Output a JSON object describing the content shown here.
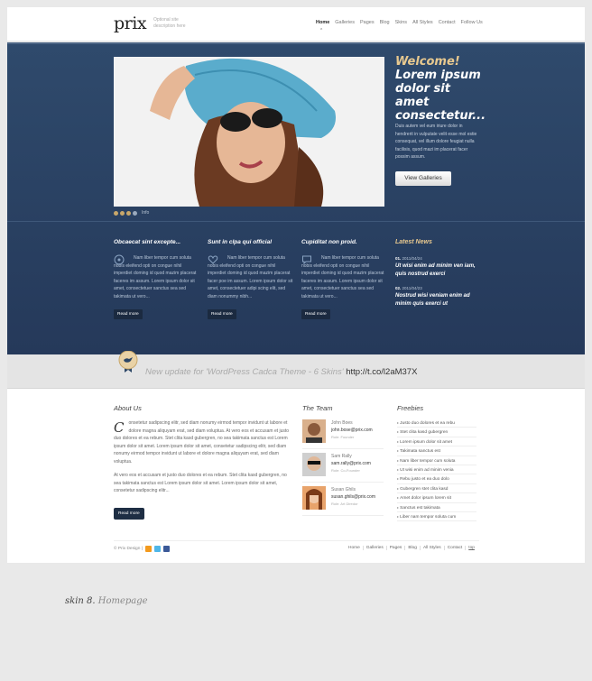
{
  "header": {
    "logo": "prix",
    "tagline": "Optional site description here",
    "nav": [
      "Home",
      "Galleries",
      "Pages",
      "Blog",
      "Skins",
      "All Styles",
      "Contact",
      "Follow Us"
    ]
  },
  "hero": {
    "welcome": "Welcome!",
    "headline": "Lorem ipsum dolor sit amet consectetur...",
    "text": "Duis autem vel eum iriure dolor in hendrerit in vulputate velit esse mol estie consequat, vel illum dolore feugiat nulla facilisis, quod mazi im placerat facer possim assum.",
    "button": "View Galleries",
    "slider_info": "Info"
  },
  "features": [
    {
      "title": "Obcaecat sint excepte...",
      "text": "Nam liber tempor cum soluta nobis eleifend opti on congue nihil imperdiet doming id quod mazim placerat faceres im assum. Lorem ipsum dolor sit amet, consectetuer sanctus sea sed takimata ut vero...",
      "button": "Read more",
      "icon": "circle-icon"
    },
    {
      "title": "Sunt in clpa qui official",
      "text": "Nam liber tempor cum soluta nobis eleifend opti on congue nihil imperdiet doming id quod mazim placerat facer poe im assum. Lorem ipsum dolor sit amet, consectetuer adipi scing elit, sed diam nonummy nibh...",
      "button": "Read more",
      "icon": "heart-icon"
    },
    {
      "title": "Cupiditat non proid.",
      "text": "Nam liber tempor cum soluta nobis eleifend opti on congue nihil imperdiet doming id quod mazim placerat faceres im assum. Lorem ipsum dolor sit amet, consectetuer sanctus sea sed takimata ut vero...",
      "button": "Read more",
      "icon": "comment-icon"
    }
  ],
  "news": {
    "title": "Latest News",
    "items": [
      {
        "num": "01.",
        "date": "2011/04/24",
        "text": "Ut wisi enim ad minim ven iam, quis nostrud exerci"
      },
      {
        "num": "02.",
        "date": "2011/04/23",
        "text": "Nostrud wisi veniam enim ad minim quis exerci ut"
      }
    ]
  },
  "ribbon": {
    "text": "New update for 'WordPress Cadca Theme - 6 Skins'",
    "link": "http://t.co/l2aM37X"
  },
  "about": {
    "title": "About Us",
    "dropcap": "C",
    "p1": "onsetetur sadipscing elitr, sed diam nonumy eirmod tempor invidunt ut labore et dolore magna aliquyam erat, sed diam voluptua. At vero eos et accusam et justo duo dolores et ea rebum. Stet clita kasd gubergren, no sea takimata sanctus est Lorem ipsum dolor sit amet. Lorem ipsum dolor sit amet, consetetur sadipscing elitr, sed diam nonumy eirmod tempor invidunt ut labore et dolore magna aliquyam erat, sed diam voluptua.",
    "p2": "At vero eos et accusam et justo duo dolores et ea rebum. Stet clita kasd gubergren, no sea takimata sanctus est Lorem ipsum dolor sit amet. Lorem ipsum dolor sit amet, consetetur sadipscing elitr...",
    "button": "Read more"
  },
  "team": {
    "title": "The Team",
    "members": [
      {
        "name": "John Boes",
        "email": "john.bose@prix.com",
        "role": "Role: Founder"
      },
      {
        "name": "Sam Rally",
        "email": "sam.rally@prix.com",
        "role": "Role: Co-Founder"
      },
      {
        "name": "Susan Ghils",
        "email": "susan.ghils@prix.com",
        "role": "Role: Art Diredor"
      }
    ]
  },
  "freebies": {
    "title": "Freebies",
    "items": [
      "Justo duo dolores et ea rebu",
      "Stet clita kasd gubergren",
      "Lorem ipsum dolor sit amet",
      "Takimata sanctus est",
      "Nam liber tempor cum soluta",
      "Ut wisi enim ad minim venia",
      "Rebu justo et ea duo dolo",
      "Gubergren stet clita kasd",
      "Amet dolor ipsum lorem sit",
      "Sanctus est takimata",
      "Liber nam tempor soluta cum"
    ]
  },
  "footer": {
    "copyright": "© Prix Design |",
    "nav": [
      "Home",
      "Galleries",
      "Pages",
      "Blog",
      "All Styles",
      "Contact",
      "top"
    ]
  },
  "caption": {
    "strong": "skin 8.",
    "light": "Homepage"
  },
  "colors": {
    "hero_bg": "#2f4a6c",
    "accent": "#e8c98f",
    "button_dark": "#1e2e44"
  }
}
